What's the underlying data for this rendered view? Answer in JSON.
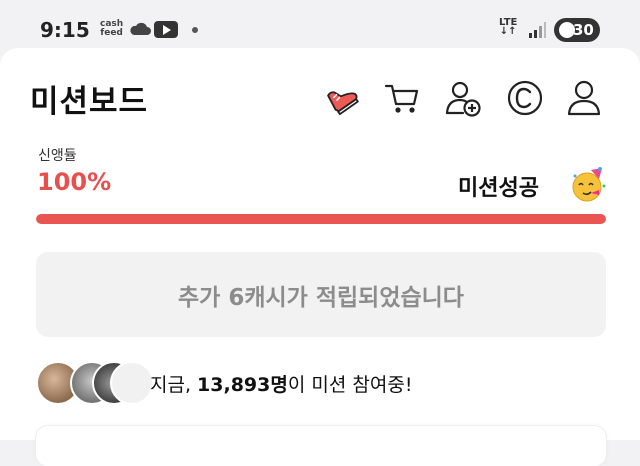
{
  "status_bar": {
    "time": "9:15",
    "cashfeed_line1": "cash",
    "cashfeed_line2": "feed",
    "network_top": "LTE",
    "network_bottom": "↓↑",
    "battery": "30"
  },
  "header": {
    "title": "미션보드",
    "icons": [
      "shoe-icon",
      "cart-icon",
      "add-user-icon",
      "coin-icon",
      "profile-icon"
    ]
  },
  "progress": {
    "label": "신앵듈",
    "value_text": "100%",
    "value": 1.0,
    "status_text": "미션성공",
    "bar_color": "#ea5451"
  },
  "reward": {
    "message": "추가 6캐시가 적립되었습니다"
  },
  "participants": {
    "prefix": "지금, ",
    "count": "13,893명",
    "suffix": "이 미션 참여중!"
  },
  "colors": {
    "accent": "#e8504e",
    "muted_text": "#8c8c8c",
    "panel": "#f2f2f2"
  }
}
